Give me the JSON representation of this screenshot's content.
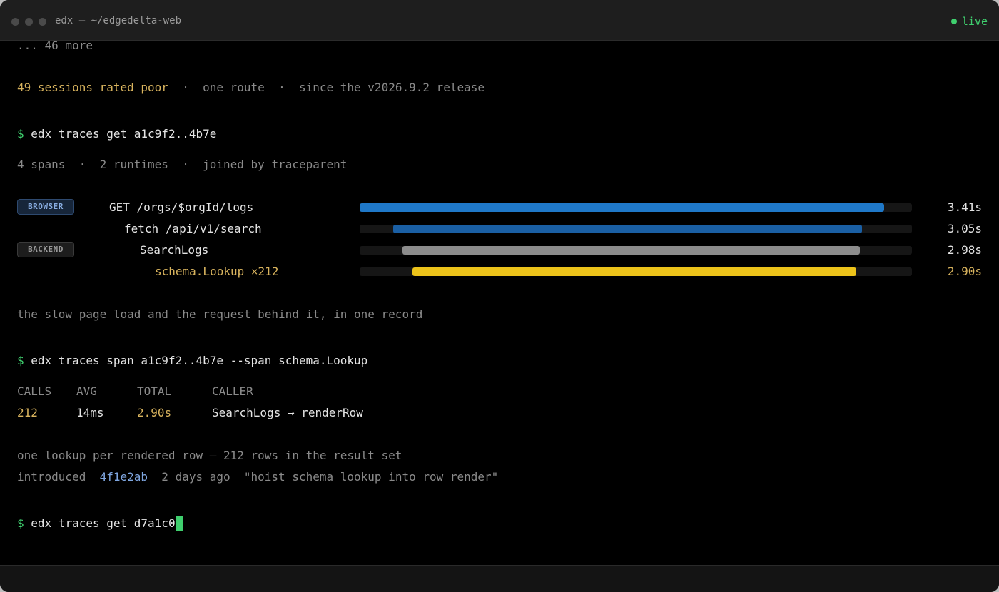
{
  "window": {
    "title": "edx — ~/edgedelta-web",
    "status": "live",
    "status_color": "#3fcf6e"
  },
  "terminal": {
    "more_line": "... 46 more",
    "summary": {
      "highlight": "49 sessions rated poor",
      "sep": "·",
      "part2": "one route",
      "part3": "since the v2026.9.2 release"
    },
    "cmd1": {
      "prompt": "$",
      "text": "edx traces get a1c9f2..4b7e"
    },
    "trace_meta": {
      "part1": "4 spans",
      "sep": "·",
      "part2": "2 runtimes",
      "part3": "joined by traceparent"
    },
    "spans": [
      {
        "badge": "BROWSER",
        "name": "GET /orgs/$orgId/logs",
        "duration": "3.41s",
        "start": 0.0,
        "end": 0.949,
        "color": "#1f78c8"
      },
      {
        "badge": "",
        "name": "fetch /api/v1/search",
        "duration": "3.05s",
        "start": 0.061,
        "end": 0.91,
        "color": "#1a5fa4"
      },
      {
        "badge": "BACKEND",
        "name": "SearchLogs",
        "duration": "2.98s",
        "start": 0.078,
        "end": 0.906,
        "color": "#8c8c8c"
      },
      {
        "badge": "",
        "name": "schema.Lookup ×212",
        "duration": "2.90s",
        "start": 0.095,
        "end": 0.899,
        "color": "#ecc31a"
      }
    ],
    "note1": "the slow page load and the request behind it, in one record",
    "cmd2": {
      "prompt": "$",
      "text": "edx traces span a1c9f2..4b7e --span schema.Lookup"
    },
    "table": {
      "headers": [
        "CALLS",
        "AVG",
        "TOTAL",
        "CALLER"
      ],
      "row": [
        "212",
        "14ms",
        "2.90s",
        "SearchLogs → renderRow"
      ]
    },
    "note2": "one lookup per rendered row — 212 rows in the result set",
    "intro": {
      "label": "introduced",
      "commit": "4f1e2ab",
      "ago": "2 days ago",
      "message": "\"hoist schema lookup into row render\""
    },
    "cmd3": {
      "prompt": "$",
      "text": "edx traces get d7a1c0"
    }
  }
}
